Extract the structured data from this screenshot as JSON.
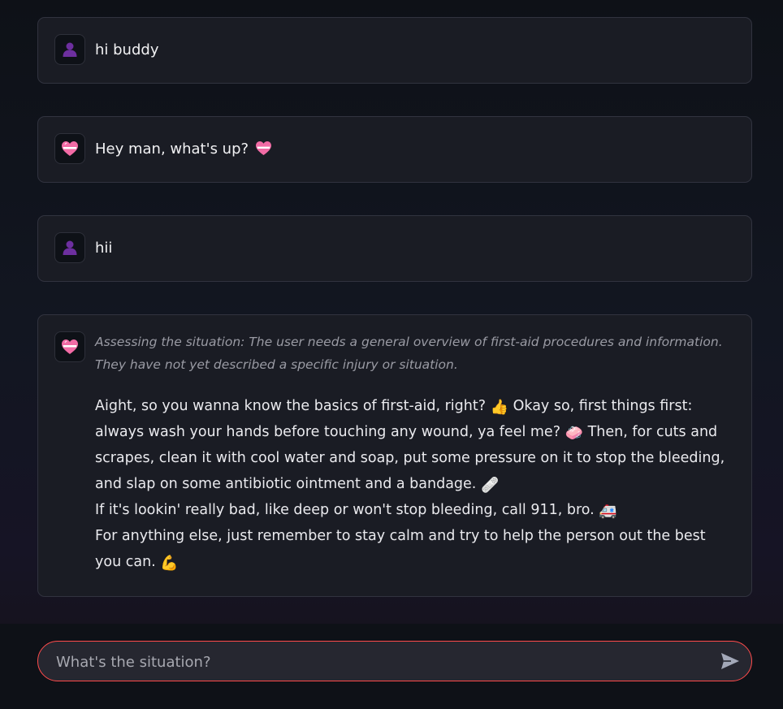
{
  "theme": {
    "background": "#0e1117",
    "message_background": "#1a1c24",
    "message_border": "#31333f",
    "input_background": "#262730",
    "input_border_accent": "#ff4b4b"
  },
  "messages": [
    {
      "role": "user",
      "avatar_icon": "user-silhouette-icon",
      "text": "hi buddy"
    },
    {
      "role": "assistant",
      "avatar_icon": "heart-icon",
      "text": "Hey man, what's up?",
      "trailing_icon": "heart-icon"
    },
    {
      "role": "user",
      "avatar_icon": "user-silhouette-icon",
      "text": "hii"
    },
    {
      "role": "assistant",
      "avatar_icon": "heart-icon",
      "thought": "Assessing the situation: The user needs a general overview of first-aid procedures and information. They have not yet described a specific injury or situation.",
      "reply": {
        "p1_a": "Aight, so you wanna know the basics of first-aid, right?",
        "p1_emoji_1": "👍",
        "p1_b": "Okay so, first things first: always wash your hands before touching any wound, ya feel me?",
        "p1_emoji_2": "🧼",
        "p1_c": "Then, for cuts and scrapes, clean it with cool water and soap, put some pressure on it to stop the bleeding, and slap on some antibiotic ointment and a bandage.",
        "p1_emoji_3": "🩹",
        "p2": "If it's lookin' really bad, like deep or won't stop bleeding, call 911, bro.",
        "p2_emoji": "🚑",
        "p3": "For anything else, just remember to stay calm and try to help the person out the best you can.",
        "p3_emoji": "💪"
      }
    }
  ],
  "chat_input": {
    "placeholder": "What's the situation?",
    "value": "",
    "send_icon": "send-arrow-icon"
  }
}
